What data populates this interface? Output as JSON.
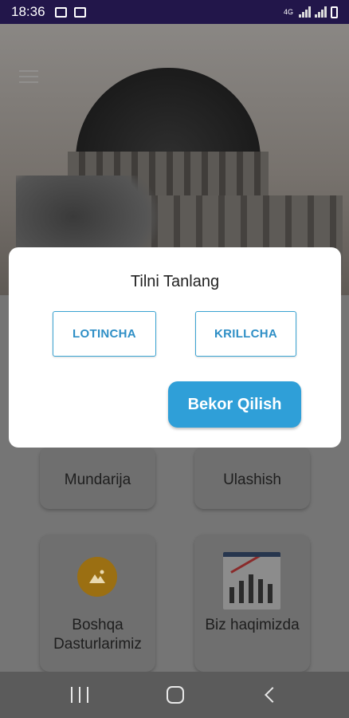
{
  "status_bar": {
    "time": "18:36",
    "network": "4G",
    "icons": [
      "gallery-icon",
      "notification-icon",
      "signal-icon",
      "battery-icon"
    ]
  },
  "header": {
    "image": "mosque-dome-image"
  },
  "grid": {
    "items": [
      {
        "label": "Mundarija"
      },
      {
        "label": "Ulashish"
      },
      {
        "label": "Boshqa Dasturlarimiz",
        "icon": "apps-icon",
        "icon_color": "#9b6f12"
      },
      {
        "label": "Biz haqimizda",
        "icon": "team-growth-icon"
      }
    ]
  },
  "dialog": {
    "title": "Tilni Tanlang",
    "latin_label": "LOTINCHA",
    "cyrillic_label": "KRILLCHA",
    "cancel_label": "Bekor Qilish",
    "accent": "#2f9fd8"
  },
  "nav_bar": {
    "icons": [
      "recents-icon",
      "home-icon",
      "back-icon"
    ]
  }
}
